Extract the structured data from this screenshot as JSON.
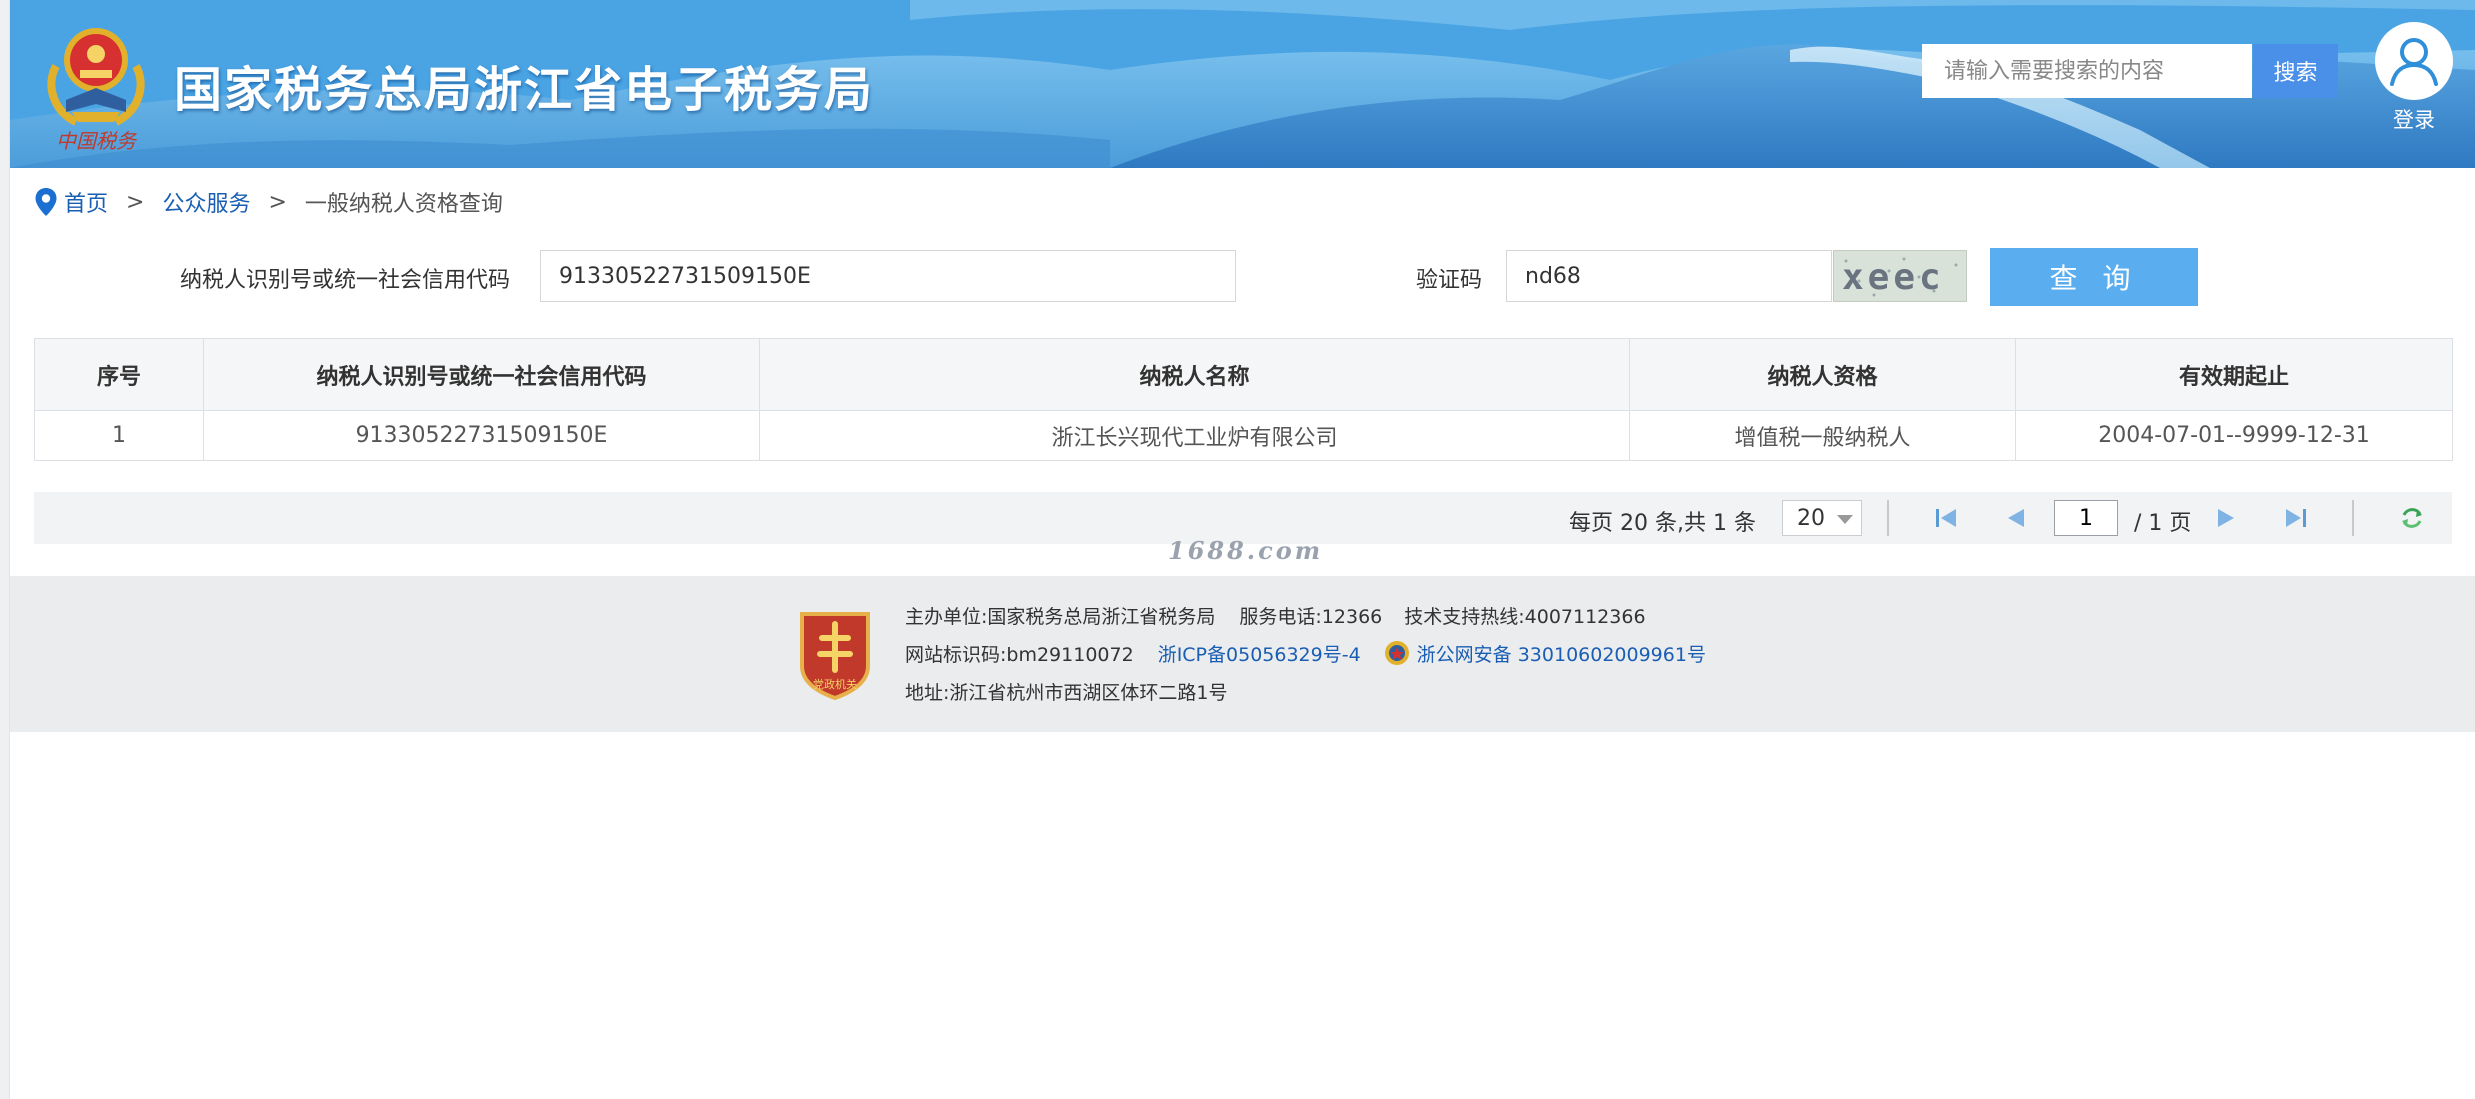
{
  "header": {
    "site_title": "国家税务总局浙江省电子税务局",
    "search_placeholder": "请输入需要搜索的内容",
    "search_button": "搜索",
    "login_label": "登录",
    "emblem_text": "中国税务"
  },
  "breadcrumb": {
    "items": [
      "首页",
      "公众服务"
    ],
    "separator": ">",
    "current": "一般纳税人资格查询"
  },
  "form": {
    "tin_label": "纳税人识别号或统一社会信用代码",
    "tin_value": "91330522731509150E",
    "captcha_label": "验证码",
    "captcha_value": "nd68",
    "captcha_image_text": "xeec",
    "query_button": "查 询"
  },
  "table": {
    "headers": [
      "序号",
      "纳税人识别号或统一社会信用代码",
      "纳税人名称",
      "纳税人资格",
      "有效期起止"
    ],
    "rows": [
      [
        "1",
        "91330522731509150E",
        "浙江长兴现代工业炉有限公司",
        "增值税一般纳税人",
        "2004-07-01--9999-12-31"
      ]
    ]
  },
  "pagination": {
    "summary": "每页 20 条,共 1 条",
    "page_size": "20",
    "current_page": "1",
    "total_pages": "/ 1 页"
  },
  "watermark": "1688.com",
  "footer": {
    "sponsor": "主办单位:国家税务总局浙江省税务局",
    "hotline": "服务电话:12366",
    "support": "技术支持热线:4007112366",
    "site_id": "网站标识码:bm29110072",
    "icp": "浙ICP备05056329号-4",
    "police_record": "浙公网安备 33010602009961号",
    "address": "地址:浙江省杭州市西湖区体环二路1号",
    "badge_text": "党政机关"
  },
  "colors": {
    "header_blue": "#3f9de0",
    "button_blue": "#4a8fe8",
    "query_blue": "#5aaef0",
    "link_blue": "#1a5eb3",
    "footer_bg": "#ebecee",
    "badge_red": "#c0392b"
  }
}
